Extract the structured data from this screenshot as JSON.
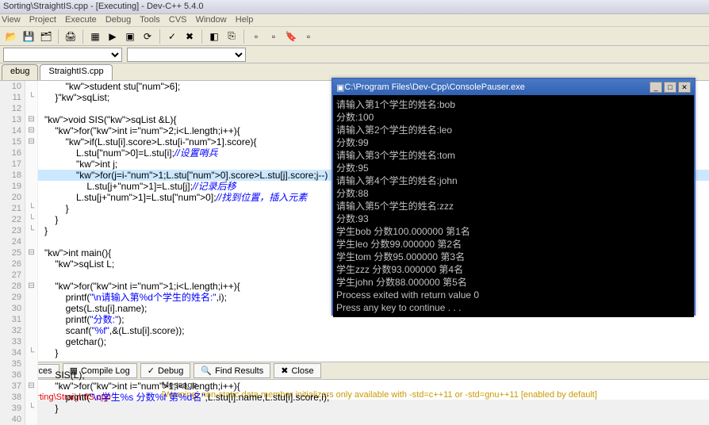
{
  "window": {
    "title": "Sorting\\StraightIS.cpp - [Executing] - Dev-C++ 5.4.0"
  },
  "menu": [
    "View",
    "Project",
    "Execute",
    "Debug",
    "Tools",
    "CVS",
    "Window",
    "Help"
  ],
  "toolbar2": {
    "find_placeholder": ""
  },
  "tabs": {
    "left": "ebug",
    "file": "StraightIS.cpp"
  },
  "code": [
    {
      "n": 10,
      "f": "",
      "t": "        student stu[6];"
    },
    {
      "n": 11,
      "f": "└",
      "t": "    }sqList;"
    },
    {
      "n": 12,
      "f": "",
      "t": ""
    },
    {
      "n": 13,
      "f": "⊟",
      "t": "void SIS(sqList &L){"
    },
    {
      "n": 14,
      "f": "⊟",
      "t": "    for(int i=2;i<L.length;i++){"
    },
    {
      "n": 15,
      "f": "⊟",
      "t": "        if(L.stu[i].score>L.stu[i-1].score){"
    },
    {
      "n": 16,
      "f": "",
      "t": "            L.stu[0]=L.stu[i];//设置哨兵"
    },
    {
      "n": 17,
      "f": "",
      "t": "            int j;"
    },
    {
      "n": 18,
      "f": "",
      "t": "            for(j=i-1;L.stu[0].score>L.stu[j].score;j--)",
      "hl": true
    },
    {
      "n": 19,
      "f": "",
      "t": "                L.stu[j+1]=L.stu[j];//记录后移"
    },
    {
      "n": 20,
      "f": "",
      "t": "            L.stu[j+1]=L.stu[0];//找到位置，插入元素"
    },
    {
      "n": 21,
      "f": "└",
      "t": "        }"
    },
    {
      "n": 22,
      "f": "└",
      "t": "    }"
    },
    {
      "n": 23,
      "f": "└",
      "t": "}"
    },
    {
      "n": 24,
      "f": "",
      "t": ""
    },
    {
      "n": 25,
      "f": "⊟",
      "t": "int main(){"
    },
    {
      "n": 26,
      "f": "",
      "t": "    sqList L;"
    },
    {
      "n": 27,
      "f": "",
      "t": ""
    },
    {
      "n": 28,
      "f": "⊟",
      "t": "    for(int i=1;i<L.length;i++){"
    },
    {
      "n": 29,
      "f": "",
      "t": "        printf(\"\\n请输入第%d个学生的姓名:\",i);"
    },
    {
      "n": 30,
      "f": "",
      "t": "        gets(L.stu[i].name);"
    },
    {
      "n": 31,
      "f": "",
      "t": "        printf(\"分数:\");"
    },
    {
      "n": 32,
      "f": "",
      "t": "        scanf(\"%f\",&(L.stu[i].score));"
    },
    {
      "n": 33,
      "f": "",
      "t": "        getchar();"
    },
    {
      "n": 34,
      "f": "└",
      "t": "    }"
    },
    {
      "n": 35,
      "f": "",
      "t": ""
    },
    {
      "n": 36,
      "f": "",
      "t": "    SIS(L);"
    },
    {
      "n": 37,
      "f": "⊟",
      "t": "    for(int i=1;i<L.length;i++){"
    },
    {
      "n": 38,
      "f": "",
      "t": "        printf(\"\\n学生%s 分数%f 第%d名\",L.stu[i].name,L.stu[i].score,i);"
    },
    {
      "n": 39,
      "f": "└",
      "t": "    }"
    },
    {
      "n": 40,
      "f": "",
      "t": ""
    }
  ],
  "console": {
    "title": "C:\\Program Files\\Dev-Cpp\\ConsolePauser.exe",
    "icon": "▣",
    "lines": [
      "请输入第1个学生的姓名:bob",
      "分数:100",
      "",
      "请输入第2个学生的姓名:leo",
      "分数:99",
      "",
      "请输入第3个学生的姓名:tom",
      "分数:95",
      "",
      "请输入第4个学生的姓名:john",
      "分数:88",
      "",
      "请输入第5个学生的姓名:zzz",
      "分数:93",
      "",
      "学生bob 分数100.000000 第1名",
      "学生leo 分数99.000000 第2名",
      "学生tom 分数95.000000 第3名",
      "学生zzz 分数93.000000 第4名",
      "学生john 分数88.000000 第5名",
      "",
      "Process exited with return value 0",
      "Press any key to continue . . ."
    ]
  },
  "bottom_tabs": {
    "resources": "Resources",
    "compile": "Compile Log",
    "debug": "Debug",
    "find": "Find Results",
    "close": "Close"
  },
  "messages": {
    "header": "Message",
    "file": "…路)\\Sorting\\StraightIS.cpp",
    "text": "[Warning] non-static data member initializers only available with -std=c++11 or -std=gnu++11 [enabled by default]"
  }
}
